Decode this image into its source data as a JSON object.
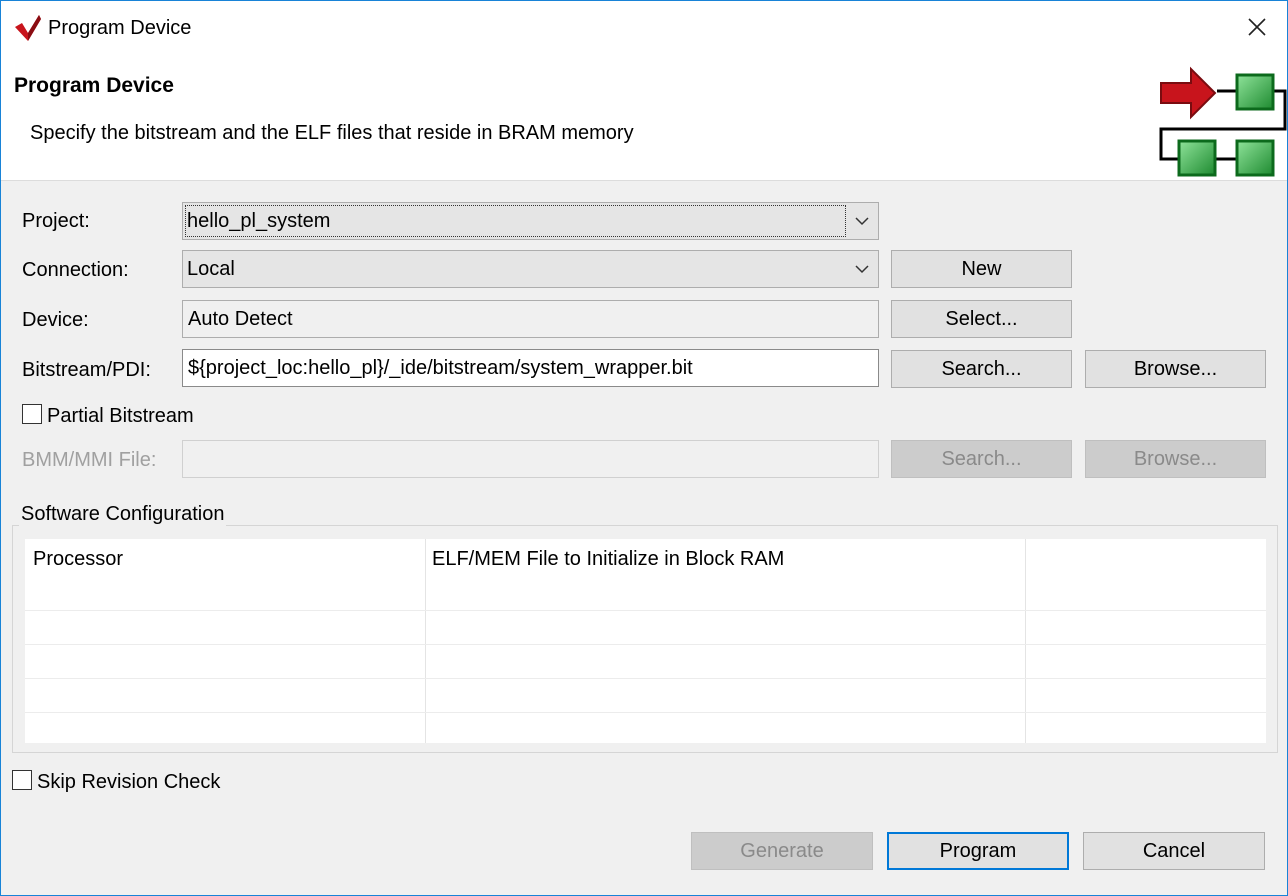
{
  "window": {
    "title": "Program Device",
    "close_glyph": "✕"
  },
  "header": {
    "title": "Program Device",
    "description": "Specify the bitstream and the ELF files that reside in BRAM memory",
    "graphic_icon": "program-flow-graphic"
  },
  "form": {
    "project_label": "Project:",
    "project_value": "hello_pl_system",
    "connection_label": "Connection:",
    "connection_value": "Local",
    "new_button": "New",
    "device_label": "Device:",
    "device_value": "Auto Detect",
    "select_button": "Select...",
    "bitstream_label": "Bitstream/PDI:",
    "bitstream_value": "${project_loc:hello_pl}/_ide/bitstream/system_wrapper.bit",
    "bitstream_search_button": "Search...",
    "bitstream_browse_button": "Browse...",
    "partial_bitstream_label": "Partial Bitstream",
    "partial_bitstream_checked": false,
    "bmm_label": "BMM/MMI File:",
    "bmm_value": "",
    "bmm_search_button": "Search...",
    "bmm_browse_button": "Browse..."
  },
  "software_config": {
    "group_label": "Software Configuration",
    "columns": [
      "Processor",
      "ELF/MEM File to Initialize in Block RAM",
      ""
    ],
    "rows": []
  },
  "skip_revision_check": {
    "label": "Skip Revision Check",
    "checked": false
  },
  "footer": {
    "generate_button": "Generate",
    "program_button": "Program",
    "cancel_button": "Cancel"
  },
  "colors": {
    "window_border": "#1883d7",
    "default_button_border": "#0078d7",
    "arrow_red": "#c0141c",
    "block_green": "#2a9a3a"
  }
}
